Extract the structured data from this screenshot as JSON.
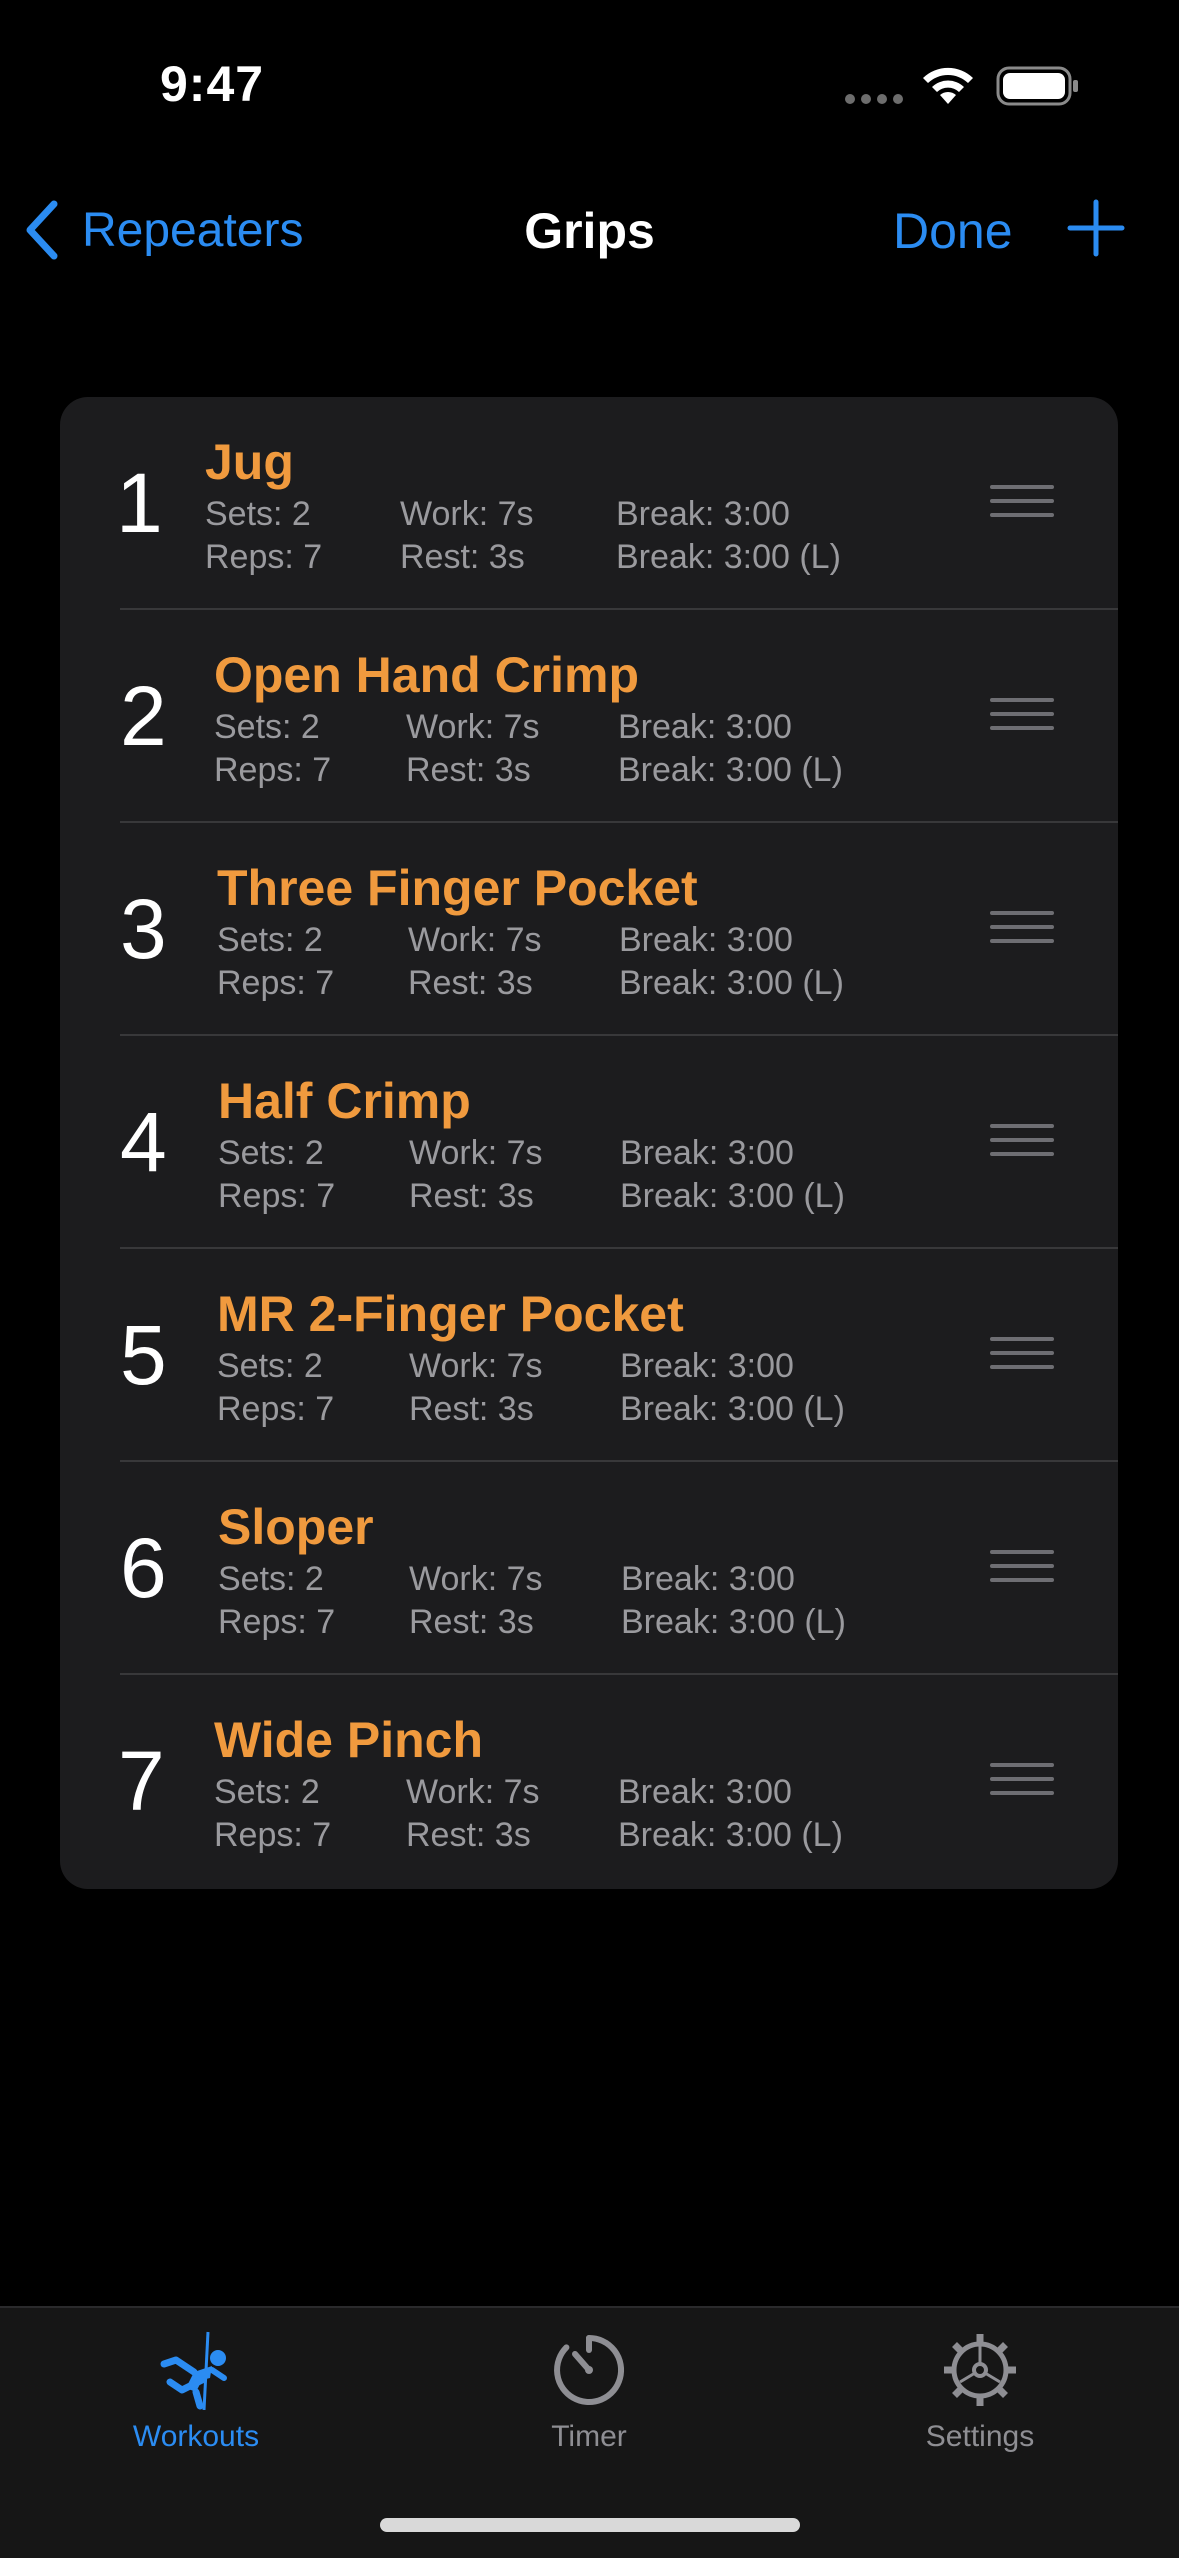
{
  "status_bar": {
    "time": "9:47"
  },
  "nav": {
    "back_label": "Repeaters",
    "title": "Grips",
    "done_label": "Done"
  },
  "grips": [
    {
      "index": "1",
      "name": "Jug",
      "sets": "Sets: 2",
      "reps": "Reps: 7",
      "work": "Work: 7s",
      "rest": "Rest: 3s",
      "break": "Break: 3:00",
      "break_long": "Break: 3:00 (L)"
    },
    {
      "index": "2",
      "name": "Open Hand Crimp",
      "sets": "Sets: 2",
      "reps": "Reps: 7",
      "work": "Work: 7s",
      "rest": "Rest: 3s",
      "break": "Break: 3:00",
      "break_long": "Break: 3:00 (L)"
    },
    {
      "index": "3",
      "name": "Three Finger Pocket",
      "sets": "Sets: 2",
      "reps": "Reps: 7",
      "work": "Work: 7s",
      "rest": "Rest: 3s",
      "break": "Break: 3:00",
      "break_long": "Break: 3:00 (L)"
    },
    {
      "index": "4",
      "name": "Half Crimp",
      "sets": "Sets: 2",
      "reps": "Reps: 7",
      "work": "Work: 7s",
      "rest": "Rest: 3s",
      "break": "Break: 3:00",
      "break_long": "Break: 3:00 (L)"
    },
    {
      "index": "5",
      "name": "MR 2-Finger Pocket",
      "sets": "Sets: 2",
      "reps": "Reps: 7",
      "work": "Work: 7s",
      "rest": "Rest: 3s",
      "break": "Break: 3:00",
      "break_long": "Break: 3:00 (L)"
    },
    {
      "index": "6",
      "name": "Sloper",
      "sets": "Sets: 2",
      "reps": "Reps: 7",
      "work": "Work: 7s",
      "rest": "Rest: 3s",
      "break": "Break: 3:00",
      "break_long": "Break: 3:00 (L)"
    },
    {
      "index": "7",
      "name": "Wide Pinch",
      "sets": "Sets: 2",
      "reps": "Reps: 7",
      "work": "Work: 7s",
      "rest": "Rest: 3s",
      "break": "Break: 3:00",
      "break_long": "Break: 3:00 (L)"
    }
  ],
  "tabs": [
    {
      "label": "Workouts",
      "icon": "climber-icon",
      "active": true
    },
    {
      "label": "Timer",
      "icon": "timer-icon",
      "active": false
    },
    {
      "label": "Settings",
      "icon": "gear-icon",
      "active": false
    }
  ],
  "colors": {
    "accent": "#2b8cf2",
    "grip_name": "#f09a3e",
    "tab_inactive": "#8e8e93",
    "background": "#000000",
    "card": "#1c1c1e"
  }
}
